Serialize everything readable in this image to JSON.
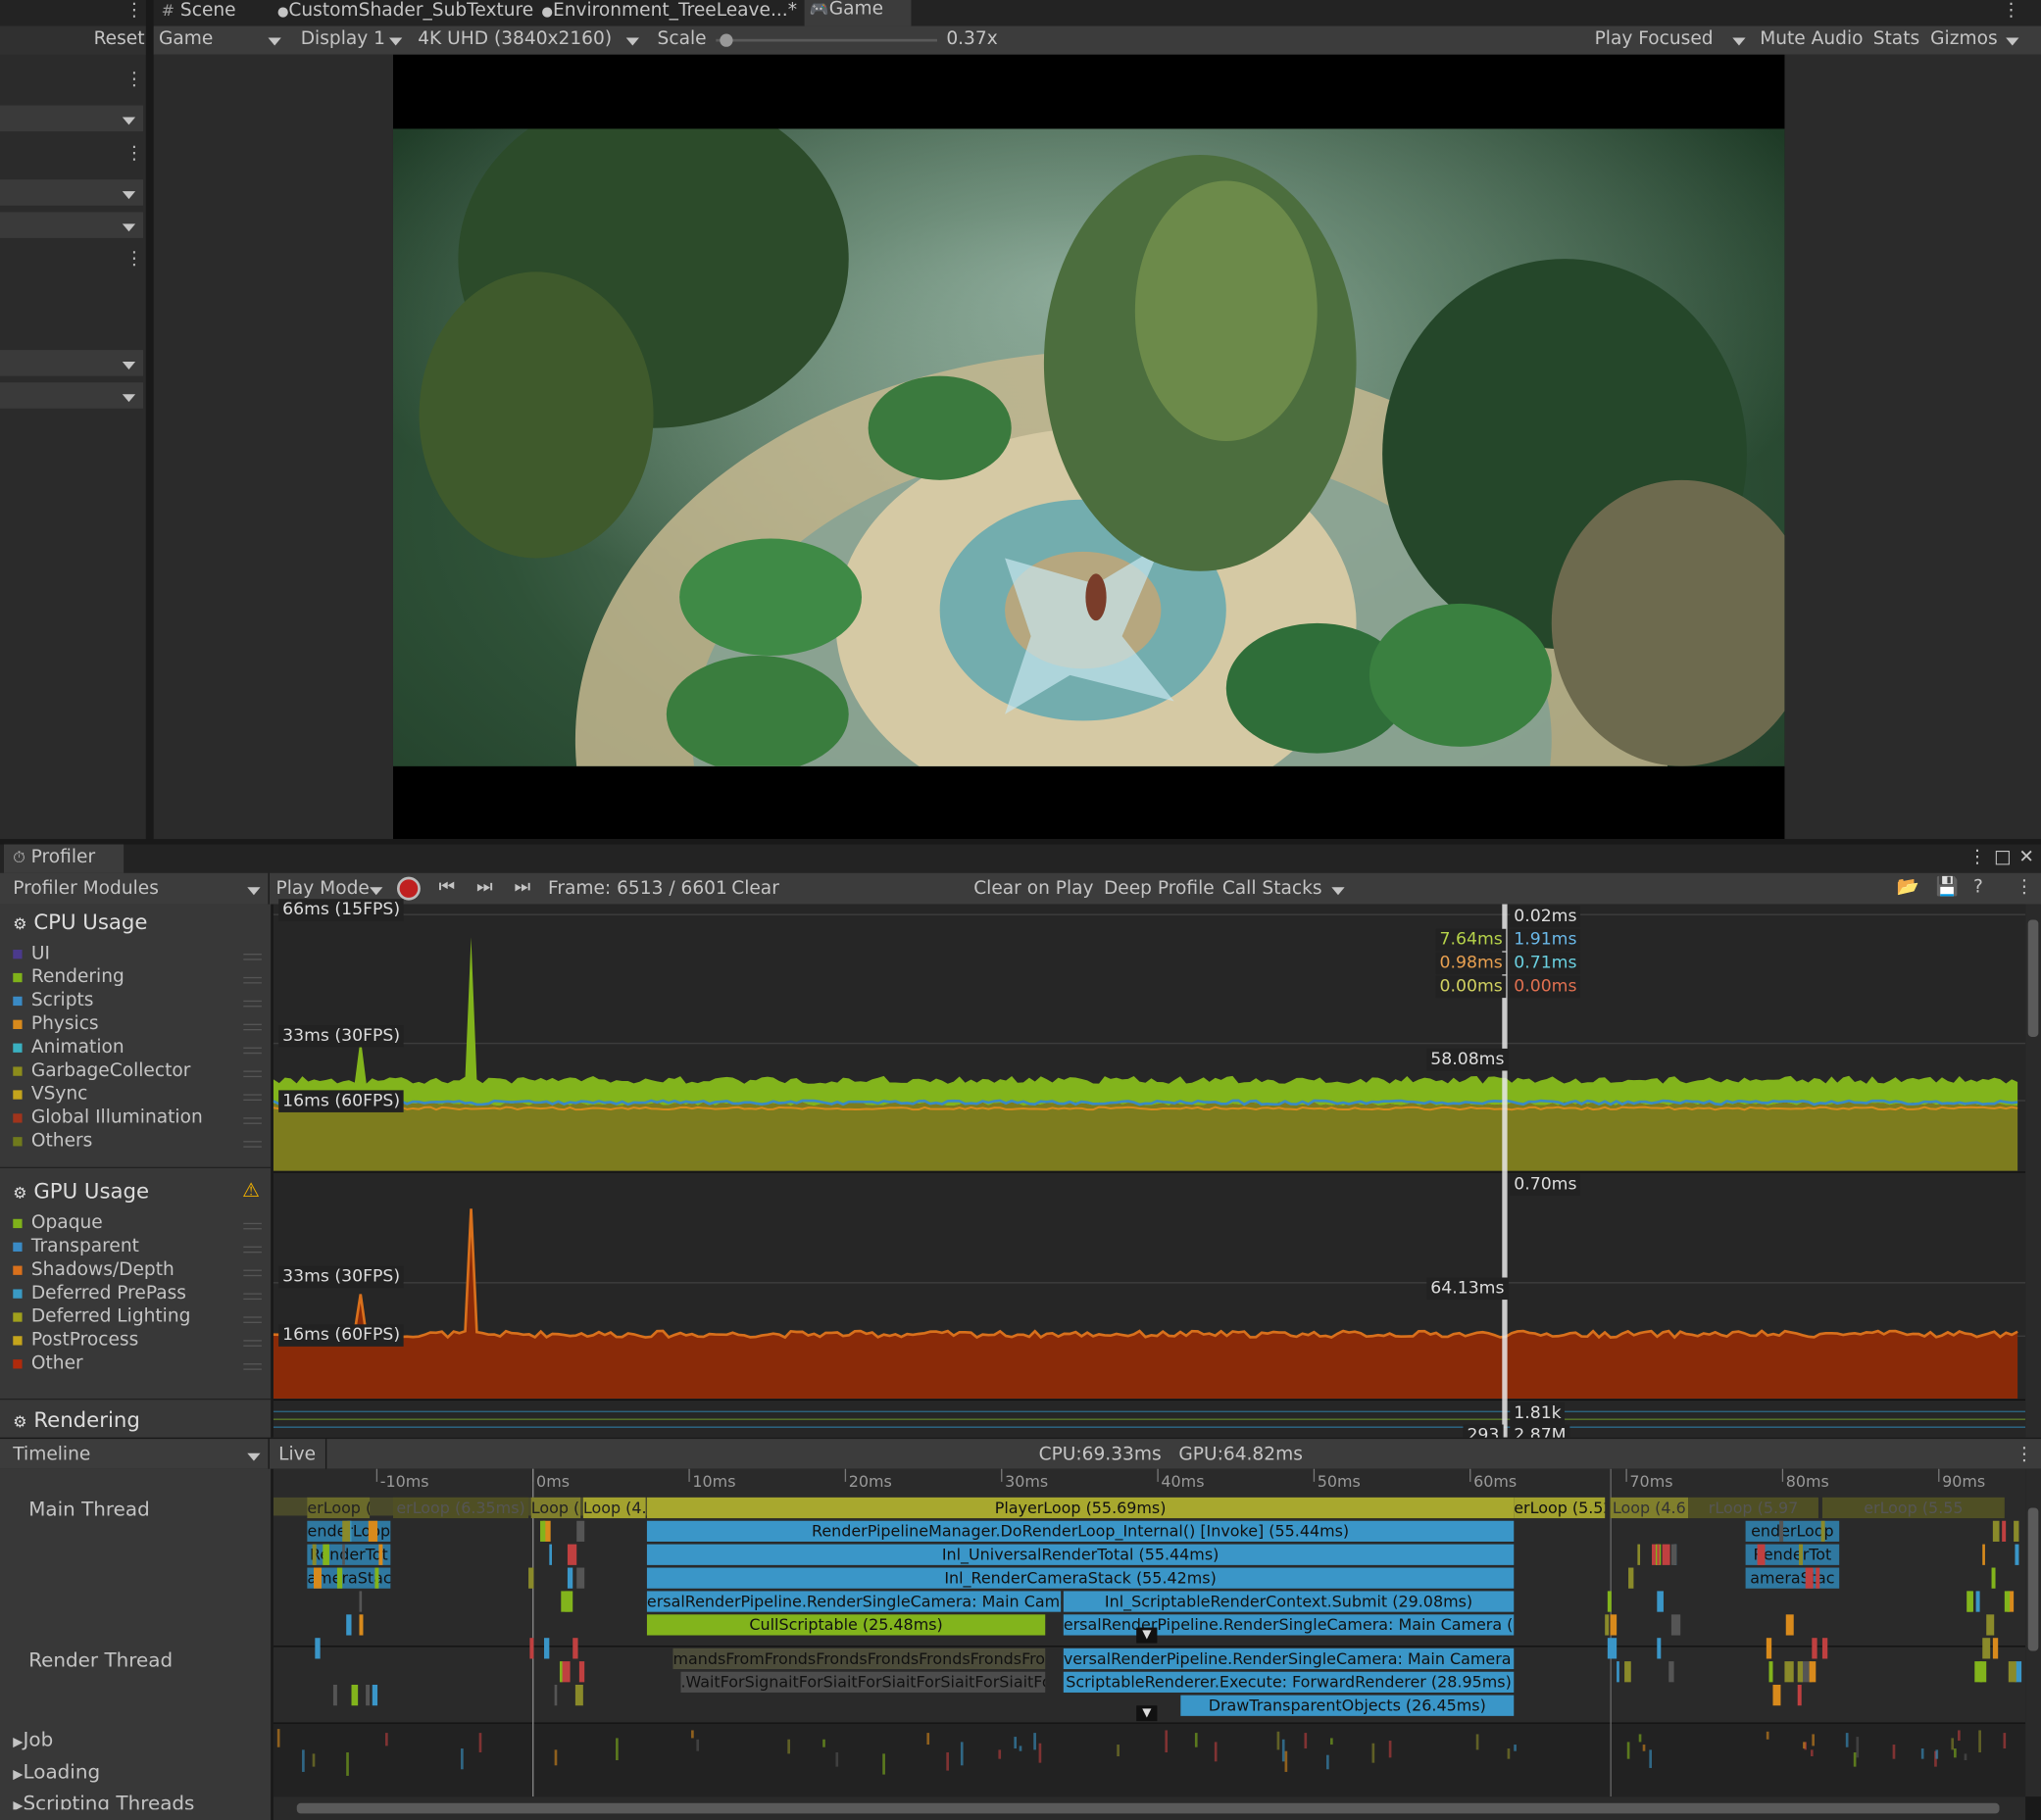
{
  "game_tabs": [
    "Scene",
    "CustomShader_SubTexture",
    "Environment_TreeLeave...*",
    "Game"
  ],
  "toolbar": {
    "reset": "Reset",
    "game_view": "Game",
    "display": "Display 1",
    "resolution": "4K UHD (3840x2160)",
    "scale_label": "Scale",
    "scale_value": "0.37x",
    "scale_fraction": 0.02,
    "play_focused": "Play Focused",
    "mute_audio": "Mute Audio",
    "stats": "Stats",
    "gizmos": "Gizmos"
  },
  "profiler": {
    "tab_title": "Profiler",
    "modules_dropdown": "Profiler Modules",
    "play_mode": "Play Mode",
    "frame": "Frame: 6513 / 6601",
    "clear": "Clear",
    "clear_on_play": "Clear on Play",
    "deep_profile": "Deep Profile",
    "call_stacks": "Call Stacks",
    "cpu": {
      "title": "CPU Usage",
      "legend": [
        {
          "label": "UI",
          "color": "#4b3a8c"
        },
        {
          "label": "Rendering",
          "color": "#7fb21a"
        },
        {
          "label": "Scripts",
          "color": "#3a8ac4"
        },
        {
          "label": "Physics",
          "color": "#d88a1c"
        },
        {
          "label": "Animation",
          "color": "#3ab0c0"
        },
        {
          "label": "GarbageCollector",
          "color": "#8c8c1c"
        },
        {
          "label": "VSync",
          "color": "#c4a41c"
        },
        {
          "label": "Global Illumination",
          "color": "#a0341c"
        },
        {
          "label": "Others",
          "color": "#707a1c"
        }
      ],
      "top_label": "66ms (15FPS)",
      "mid_label": "33ms (30FPS)",
      "low_label": "16ms (60FPS)",
      "values_left": [
        "7.64ms",
        "0.98ms",
        "0.00ms"
      ],
      "values_right": [
        "0.02ms",
        "1.91ms",
        "0.71ms",
        "0.00ms"
      ],
      "total": "58.08ms"
    },
    "gpu": {
      "title": "GPU Usage",
      "legend": [
        {
          "label": "Opaque",
          "color": "#7fb21a"
        },
        {
          "label": "Transparent",
          "color": "#3a8ac4"
        },
        {
          "label": "Shadows/Depth",
          "color": "#d8701c"
        },
        {
          "label": "Deferred PrePass",
          "color": "#3a9ac4"
        },
        {
          "label": "Deferred Lighting",
          "color": "#a0a01c"
        },
        {
          "label": "PostProcess",
          "color": "#c4a41c"
        },
        {
          "label": "Other",
          "color": "#b02a0c"
        }
      ],
      "mid_label": "33ms (30FPS)",
      "low_label": "16ms (60FPS)",
      "top_value": "0.70ms",
      "total": "64.13ms"
    },
    "rendering": {
      "title": "Rendering",
      "value1": "1.81k",
      "value2": "293",
      "value3": "2.87M"
    },
    "timeline": {
      "view": "Timeline",
      "live": "Live",
      "stats": "CPU:69.33ms   GPU:64.82ms",
      "ticks": [
        "-10ms",
        "0ms",
        "10ms",
        "20ms",
        "30ms",
        "40ms",
        "50ms",
        "60ms",
        "70ms",
        "80ms",
        "90ms"
      ],
      "threads": [
        "Main Thread",
        "Render Thread",
        "Job",
        "Loading",
        "Scripting Threads"
      ],
      "blocks": {
        "playerloop": "PlayerLoop (55.69ms)",
        "dorenderloop": "RenderPipelineManager.DoRenderLoop_Internal() [Invoke] (55.44ms)",
        "urt": "Inl_UniversalRenderTotal (55.44ms)",
        "rcs": "Inl_RenderCameraStack (55.42ms)",
        "rsc_left": "ersalRenderPipeline.RenderSingleCamera: Main Camera (2",
        "submit": "Inl_ScriptableRenderContext.Submit (29.08ms)",
        "cull": "CullScriptable (25.48ms)",
        "rsc_right": "ersalRenderPipeline.RenderSingleCamera: Main Camera (28.5",
        "rt_left": "mandsFromFrondsFrondsFrondsFrondsFrondsFro",
        "rt_rsc": "versalRenderPipeline.RenderSingleCamera: Main Camera (28.97",
        "waitsig": ".WaitForSignaitForSiaitForSiaitForSiaitForSiaitForSi",
        "execute": "ScriptableRenderer.Execute: ForwardRenderer (28.95ms)",
        "drawtrans": "DrawTransparentObjects (26.45ms)",
        "loop_left1": "erLoop (5.35ms)",
        "loop_left2": "erLoop (6.35ms)",
        "loop_left3": "Loop (3",
        "loop_left4": "Loop (4.2",
        "loop_right1": "erLoop (5.52",
        "loop_right2": "Loop (4.6",
        "loop_right3": "rLoop (5.97",
        "loop_right4": "erLoop (5.55",
        "small1": "enderLoop",
        "small2": "RenderTot",
        "small3": "ameraStac"
      }
    }
  },
  "chart_data": [
    {
      "type": "area",
      "title": "CPU Usage",
      "ylabel": "",
      "reference_lines": [
        "66ms (15FPS)",
        "33ms (30FPS)",
        "16ms (60FPS)"
      ],
      "series": [
        {
          "name": "Rendering",
          "typical_ms": 7.6
        },
        {
          "name": "Others",
          "typical_ms": 15
        }
      ],
      "selected_total_ms": 58.08,
      "grid": true
    },
    {
      "type": "area",
      "title": "GPU Usage",
      "reference_lines": [
        "33ms (30FPS)",
        "16ms (60FPS)"
      ],
      "series": [
        {
          "name": "Other",
          "typical_ms": 15
        }
      ],
      "selected_total_ms": 64.13,
      "grid": true
    }
  ]
}
